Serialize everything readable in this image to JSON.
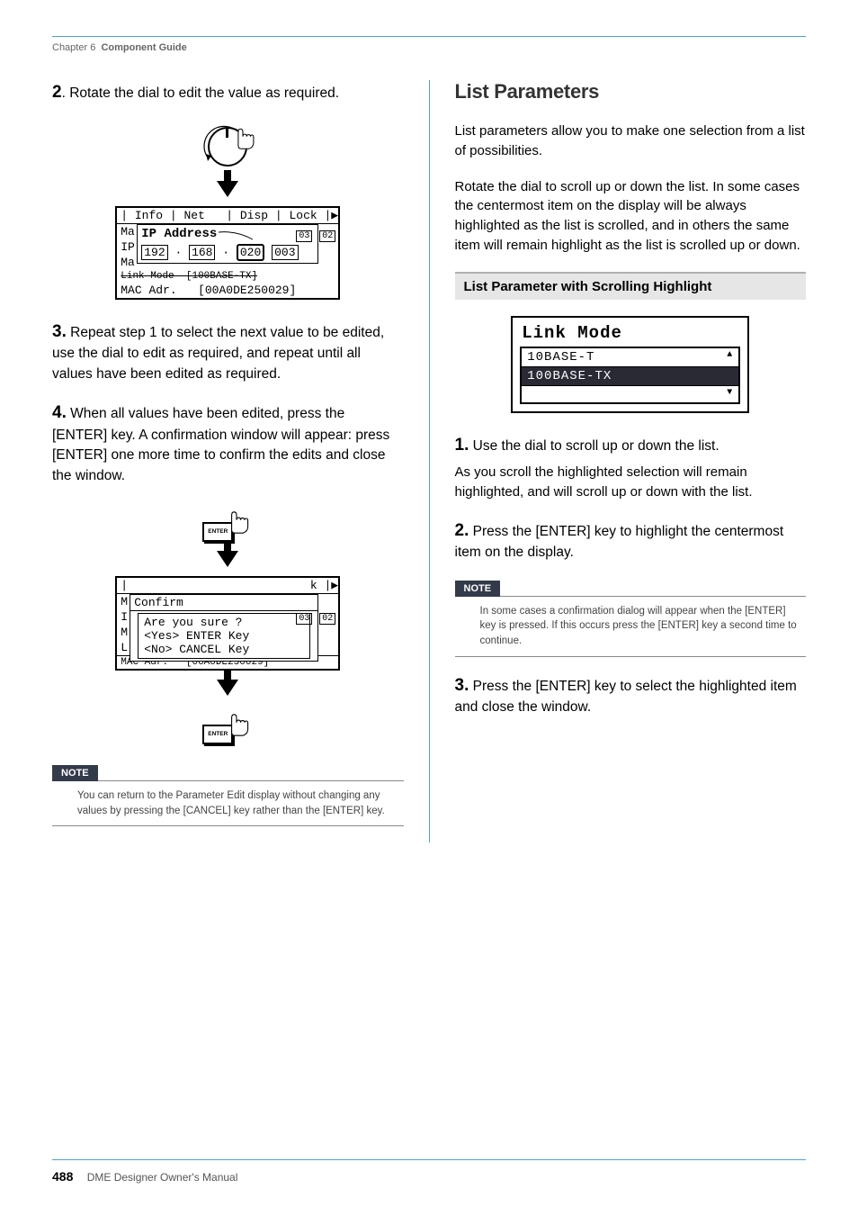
{
  "header": {
    "chapter": "Chapter 6",
    "title": "Component Guide"
  },
  "left": {
    "step2_num": "2",
    "step2_text": ". Rotate the dial to edit the value as required.",
    "ip_screen": {
      "tabs": "| Info | Net   | Disp | Lock |▶",
      "row1": "Ma",
      "popup_title": "IP Address",
      "row_ip": "IP",
      "row_ma": "Ma",
      "ip1": "192",
      "ip2": "168",
      "ip3": "020",
      "ip4": "003",
      "side1": "03",
      "side2": "02",
      "row_link": "Link Mode  [100BASE-TX]",
      "row_mac": "MAC Adr.   [00A0DE250029]"
    },
    "step3_num": "3.",
    "step3_text": " Repeat step 1 to select the next value to be edited, use the dial to edit as required, and repeat until all values have been edited as required.",
    "step4_num": "4.",
    "step4_text": " When all values have been edited, press the [ENTER] key. A confirmation window will appear: press [ENTER] one more time to confirm the edits and close the window.",
    "enter_label": "ENTER",
    "confirm_screen": {
      "top": "|                          k |▶",
      "m1": "M",
      "title": "Confirm",
      "i1": "I",
      "line1": "Are you sure ?",
      "m2": "M",
      "line2": "<Yes>  ENTER Key",
      "l1": "L",
      "line3": "<No>   CANCEL Key",
      "side1": "03",
      "side2": "02",
      "mac": "MAC Adr.   [00A0DE250029]"
    },
    "note_label": "NOTE",
    "note_text": "You can return to the Parameter Edit display without changing any values by pressing the [CANCEL] key rather than the [ENTER] key."
  },
  "right": {
    "title": "List Parameters",
    "p1": "List parameters allow you to make one selection from a list of possibilities.",
    "p2": "Rotate the dial to scroll up or down the list. In some cases the centermost item on the display will be always highlighted as the list is scrolled, and in others the same item will remain highlight as the list is scrolled up or down.",
    "subhead": "List Parameter with Scrolling Highlight",
    "link_screen": {
      "title": "Link Mode",
      "item1": "10BASE-T",
      "item2": "100BASE-TX",
      "up": "▲",
      "down": "▼"
    },
    "step1_num": "1.",
    "step1_text": " Use the dial to scroll up or down the list.",
    "step1_cont": "As you scroll the highlighted selection will remain highlighted, and will scroll up or down with the list.",
    "step2_num": "2.",
    "step2_text": " Press the [ENTER] key to highlight the centermost item on the display.",
    "note_label": "NOTE",
    "note_text": "In some cases a confirmation dialog will appear when the [ENTER] key is pressed. If this occurs press the [ENTER] key a second time to continue.",
    "step3_num": "3.",
    "step3_text": " Press the [ENTER] key to select the highlighted item and close the window."
  },
  "footer": {
    "page": "488",
    "title": "DME Designer Owner's Manual"
  }
}
